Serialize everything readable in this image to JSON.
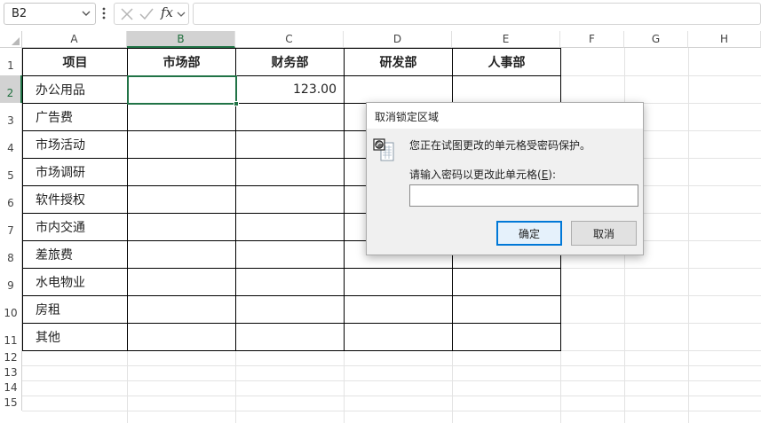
{
  "formula_bar": {
    "name_box": "B2",
    "fx": "fx",
    "formula": ""
  },
  "columns": [
    "A",
    "B",
    "C",
    "D",
    "E",
    "F",
    "G",
    "H"
  ],
  "active_column": "B",
  "rows": [
    "1",
    "2",
    "3",
    "4",
    "5",
    "6",
    "7",
    "8",
    "9",
    "10",
    "11",
    "12",
    "13",
    "14",
    "15"
  ],
  "active_row": "2",
  "table": {
    "headers": [
      "项目",
      "市场部",
      "财务部",
      "研发部",
      "人事部"
    ],
    "rows": [
      [
        "办公用品",
        "",
        "123.00",
        "",
        ""
      ],
      [
        "广告费",
        "",
        "",
        "",
        ""
      ],
      [
        "市场活动",
        "",
        "",
        "",
        ""
      ],
      [
        "市场调研",
        "",
        "",
        "",
        ""
      ],
      [
        "软件授权",
        "",
        "",
        "",
        ""
      ],
      [
        "市内交通",
        "",
        "",
        "",
        ""
      ],
      [
        "差旅费",
        "",
        "",
        "",
        ""
      ],
      [
        "水电物业",
        "",
        "",
        "",
        ""
      ],
      [
        "房租",
        "",
        "",
        "",
        ""
      ],
      [
        "其他",
        "",
        "",
        "",
        ""
      ]
    ]
  },
  "dialog": {
    "title": "取消锁定区域",
    "message": "您正在试图更改的单元格受密码保护。",
    "prompt_prefix": "请输入密码以更改此单元格(",
    "prompt_key": "E",
    "prompt_suffix": "):",
    "password_value": "",
    "ok_label": "确定",
    "cancel_label": "取消"
  },
  "colors": {
    "accent": "#217346",
    "selected_header_bg": "#d2d2d2",
    "dialog_default_button": "#0078d7"
  }
}
